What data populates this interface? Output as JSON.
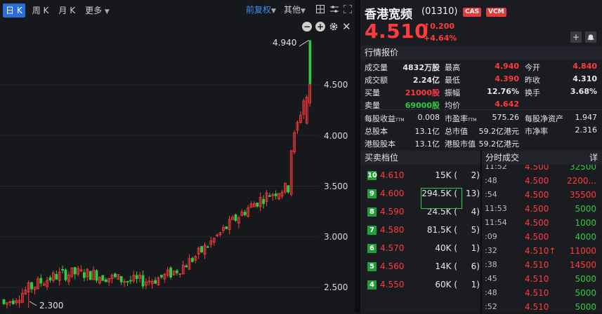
{
  "toolbar": {
    "tabs": [
      {
        "label": "日 K",
        "active": true
      },
      {
        "label": "周 K"
      },
      {
        "label": "月 K"
      },
      {
        "label": "更多"
      }
    ],
    "adjust_label": "前复权",
    "other_label": "其他"
  },
  "chart": {
    "y_ticks": [
      "4.500",
      "4.000",
      "3.500",
      "3.000",
      "2.500"
    ],
    "high_label": "4.940",
    "low_label": "2.300",
    "colors": {
      "up": "#ff3b3b",
      "down": "#2ecc40",
      "bg": "#17181c"
    }
  },
  "chart_data": {
    "type": "candlestick",
    "y_ticks": [
      4.5,
      4.0,
      3.5,
      3.0,
      2.5
    ],
    "ylim": [
      2.2,
      5.0
    ],
    "annotations": [
      {
        "text": "4.940",
        "value": 4.94
      },
      {
        "text": "2.300",
        "value": 2.3
      }
    ]
  },
  "quote": {
    "name": "香港宽频",
    "code": "(01310)",
    "badges": [
      "CAS",
      "VCM"
    ],
    "price": "4.510",
    "change": "0.200",
    "change_pct": "+4.64%"
  },
  "stats_title": "行情报价",
  "stats": [
    [
      {
        "l": "成交量",
        "v": "4832万股",
        "c": "white"
      },
      {
        "l": "最高",
        "v": "4.940",
        "c": "red"
      },
      {
        "l": "今开",
        "v": "4.840",
        "c": "red"
      }
    ],
    [
      {
        "l": "成交额",
        "v": "2.24亿",
        "c": "white"
      },
      {
        "l": "最低",
        "v": "4.390",
        "c": "red"
      },
      {
        "l": "昨收",
        "v": "4.310",
        "c": "white"
      }
    ],
    [
      {
        "l": "买量",
        "v": "21000股",
        "c": "red"
      },
      {
        "l": "振幅",
        "v": "12.76%",
        "c": "white"
      },
      {
        "l": "换手",
        "v": "3.68%",
        "c": "white"
      }
    ],
    [
      {
        "l": "卖量",
        "v": "69000股",
        "c": "green"
      },
      {
        "l": "均价",
        "v": "4.642",
        "c": "red"
      },
      {
        "l": "",
        "v": "",
        "c": "white"
      }
    ]
  ],
  "fundamentals": [
    [
      {
        "l": "每股收益",
        "ttm": "TTM",
        "v": "0.008"
      },
      {
        "l": "市盈率",
        "ttm": "TTM",
        "v": "575.26"
      },
      {
        "l": "每股净资产",
        "ttm": "",
        "v": "1.947"
      }
    ],
    [
      {
        "l": "总股本",
        "ttm": "",
        "v": "13.1亿"
      },
      {
        "l": "总市值",
        "ttm": "",
        "v": "59.2亿港元"
      },
      {
        "l": "市净率",
        "ttm": "",
        "v": "2.316"
      }
    ],
    [
      {
        "l": "港股股本",
        "ttm": "",
        "v": "13.1亿"
      },
      {
        "l": "港股市值",
        "ttm": "",
        "v": "59.2亿港元"
      },
      {
        "l": "",
        "ttm": "",
        "v": ""
      }
    ]
  ],
  "orderbook_title": "买卖档位",
  "orderbook": [
    {
      "level": "10",
      "price": "4.610",
      "vol": "15K",
      "count": "2)"
    },
    {
      "level": "9",
      "price": "4.600",
      "vol": "294.5K",
      "count": "13)"
    },
    {
      "level": "8",
      "price": "4.590",
      "vol": "24.5K",
      "count": "4)"
    },
    {
      "level": "7",
      "price": "4.580",
      "vol": "81.5K",
      "count": "5)"
    },
    {
      "level": "6",
      "price": "4.570",
      "vol": "40K",
      "count": "1)"
    },
    {
      "level": "5",
      "price": "4.560",
      "vol": "14K",
      "count": "6)"
    },
    {
      "level": "4",
      "price": "4.550",
      "vol": "60K",
      "count": "1)"
    }
  ],
  "trades_title": "分时成交",
  "trades_detail": "详",
  "trades": [
    {
      "t": "11:52",
      "p": "4.500",
      "arrow": "",
      "v": "32500",
      "c": "green"
    },
    {
      "t": ":48",
      "p": "4.500",
      "arrow": "",
      "v": "2200...",
      "c": "red"
    },
    {
      "t": ":54",
      "p": "4.500",
      "arrow": "",
      "v": "35500",
      "c": "red"
    },
    {
      "t": "11:53",
      "p": "4.500",
      "arrow": "",
      "v": "5000",
      "c": "green"
    },
    {
      "t": "11:54",
      "p": "4.500",
      "arrow": "",
      "v": "1000",
      "c": "green"
    },
    {
      "t": ":09",
      "p": "4.500",
      "arrow": "",
      "v": "4000",
      "c": "green"
    },
    {
      "t": ":32",
      "p": "4.510",
      "arrow": "↑",
      "v": "11000",
      "c": "red"
    },
    {
      "t": ":38",
      "p": "4.510",
      "arrow": "",
      "v": "14500",
      "c": "red"
    },
    {
      "t": ":45",
      "p": "4.510",
      "arrow": "",
      "v": "5000",
      "c": "green"
    },
    {
      "t": ":48",
      "p": "4.510",
      "arrow": "",
      "v": "5000",
      "c": "green"
    },
    {
      "t": ":52",
      "p": "4.510",
      "arrow": "",
      "v": "5000",
      "c": "green"
    }
  ]
}
